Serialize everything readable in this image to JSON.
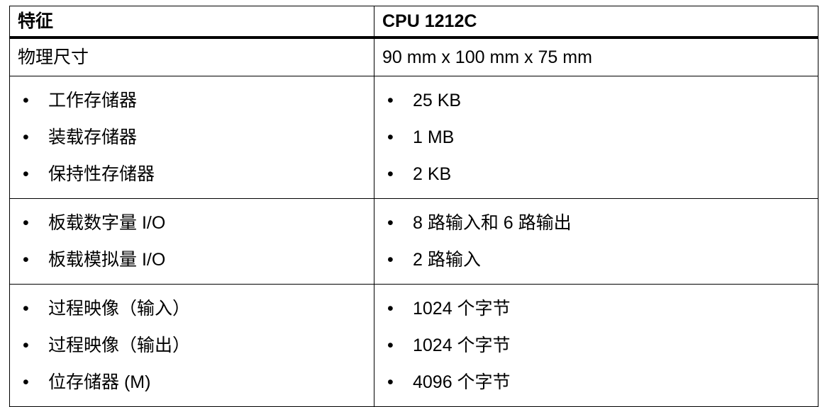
{
  "header": {
    "feature": "特征",
    "model": "CPU 1212C"
  },
  "rows": {
    "dimensions": {
      "feature": "物理尺寸",
      "value": "90 mm x 100 mm x 75 mm"
    },
    "memory": [
      {
        "feature": "工作存储器",
        "value": "25 KB"
      },
      {
        "feature": "装载存储器",
        "value": "1 MB"
      },
      {
        "feature": "保持性存储器",
        "value": "2 KB"
      }
    ],
    "io": [
      {
        "feature": "板载数字量 I/O",
        "value": "8 路输入和 6 路输出"
      },
      {
        "feature": "板载模拟量 I/O",
        "value": "2 路输入"
      }
    ],
    "process": [
      {
        "feature": "过程映像（输入）",
        "value": "1024 个字节"
      },
      {
        "feature": "过程映像（输出）",
        "value": "1024 个字节"
      },
      {
        "feature": "位存储器 (M)",
        "value": "4096 个字节"
      }
    ]
  },
  "bullet_glyph": "•"
}
